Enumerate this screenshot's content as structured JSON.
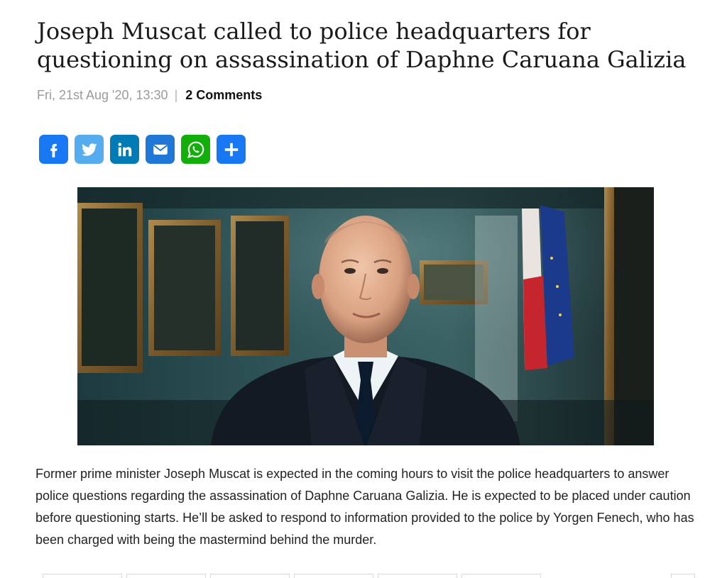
{
  "article": {
    "headline": "Joseph Muscat called to police headquarters for questioning on assassination of Daphne Caruana Galizia",
    "date": "Fri, 21st Aug '20, 13:30",
    "separator": "|",
    "comments_label": "2 Comments",
    "body": "Former prime minister Joseph Muscat is expected in the coming hours to visit the police headquarters to answer police questions regarding the assassination of Daphne Caruana Galizia. He is expected to be placed under caution before questioning starts. He’ll be asked to respond to information provided to the police by Yorgen Fenech, who has been charged with being the mastermind behind the murder."
  },
  "share_buttons": [
    {
      "icon": "facebook-icon",
      "color": "#1877f2"
    },
    {
      "icon": "twitter-icon",
      "color": "#55acee"
    },
    {
      "icon": "linkedin-icon",
      "color": "#007bb5"
    },
    {
      "icon": "email-icon",
      "color": "#1f77d8"
    },
    {
      "icon": "whatsapp-icon",
      "color": "#12af0a"
    },
    {
      "icon": "plus-icon",
      "color": "#1877f2"
    }
  ],
  "hero_image": {
    "subject": "portrait of man in dark suit in a room with framed paintings and Maltese and EU flags"
  }
}
